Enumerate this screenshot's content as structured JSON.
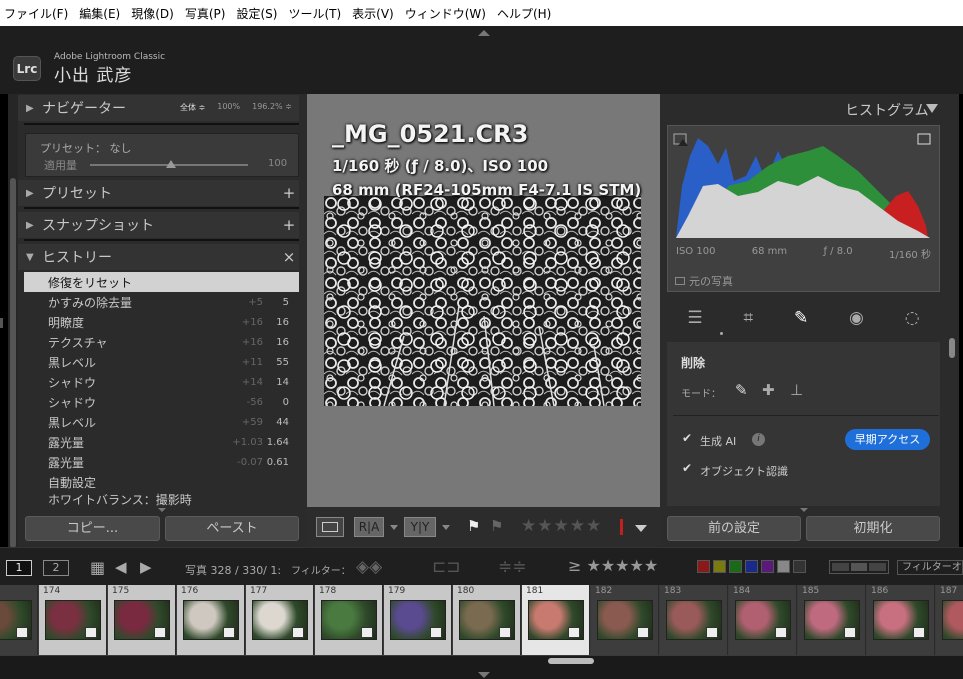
{
  "menubar": {
    "items": [
      "ファイル(F)",
      "編集(E)",
      "現像(D)",
      "写真(P)",
      "設定(S)",
      "ツール(T)",
      "表示(V)",
      "ウィンドウ(W)",
      "ヘルプ(H)"
    ]
  },
  "identity": {
    "logo": "Lrc",
    "app": "Adobe Lightroom Classic",
    "user": "小出 武彦"
  },
  "left": {
    "navigator": {
      "title": "ナビゲーター",
      "zooms": [
        "全体 ≑",
        "100%",
        "196.2% ≑"
      ]
    },
    "preset_row": {
      "label": "プリセット： なし",
      "amount_label": "適用量",
      "amount_value": "100",
      "amount_level": 0.5
    },
    "presets": {
      "title": "プリセット",
      "action": "+"
    },
    "snapshots": {
      "title": "スナップショット",
      "action": "+"
    },
    "history": {
      "title": "ヒストリー",
      "action": "×",
      "items": [
        {
          "name": "修復をリセット",
          "before": "",
          "after": ""
        },
        {
          "name": "かすみの除去量",
          "before": "+5",
          "after": "5"
        },
        {
          "name": "明瞭度",
          "before": "+16",
          "after": "16"
        },
        {
          "name": "テクスチャ",
          "before": "+16",
          "after": "16"
        },
        {
          "name": "黒レベル",
          "before": "+11",
          "after": "55"
        },
        {
          "name": "シャドウ",
          "before": "+14",
          "after": "14"
        },
        {
          "name": "シャドウ",
          "before": "-56",
          "after": "0"
        },
        {
          "name": "黒レベル",
          "before": "+59",
          "after": "44"
        },
        {
          "name": "露光量",
          "before": "+1.03",
          "after": "1.64"
        },
        {
          "name": "露光量",
          "before": "-0.07",
          "after": "0.61"
        },
        {
          "name": "自動設定",
          "before": "",
          "after": ""
        },
        {
          "name": "ホワイトバランス：撮影時",
          "before": "",
          "after": ""
        }
      ]
    },
    "copy_btn": "コピー...",
    "paste_btn": "ペースト"
  },
  "center": {
    "filename": "_MG_0521.CR3",
    "exposure": "1/160 秒 (ƒ / 8.0)、ISO 100",
    "lens": "68 mm (RF24-105mm F4-7.1 IS STM)",
    "toolbar": {
      "rating_stars": "★★★★★"
    }
  },
  "right": {
    "histogram": {
      "title": "ヒストグラム",
      "iso": "ISO 100",
      "focal": "68 mm",
      "aperture": "ƒ / 8.0",
      "shutter": "1/160 秒",
      "original": "元の写真"
    },
    "remove": {
      "title": "削除",
      "mode_label": "モード：",
      "gen_ai_label": "生成 AI",
      "early_access": "早期アクセス",
      "object_detect": "オブジェクト認識"
    },
    "prev_btn": "前の設定",
    "reset_btn": "初期化"
  },
  "filmbar": {
    "screen1": "1",
    "screen2": "2",
    "photo_info": "写真 328 / 330/ 1:",
    "filter_label": "フィルター：",
    "stars": "≥ ★★★★★",
    "filter_off": "フィルターオフ"
  },
  "colors": {
    "accent": "#1e6fd9",
    "panel": "#2b2b2b",
    "selected": "#d2d2d2"
  },
  "film": [
    {
      "n": "",
      "sel": false
    },
    {
      "n": "174",
      "sel": false
    },
    {
      "n": "175",
      "sel": false
    },
    {
      "n": "176",
      "sel": false
    },
    {
      "n": "177",
      "sel": false
    },
    {
      "n": "178",
      "sel": false
    },
    {
      "n": "179",
      "sel": false
    },
    {
      "n": "180",
      "sel": false
    },
    {
      "n": "181",
      "sel": true
    },
    {
      "n": "182",
      "sel": false
    },
    {
      "n": "183",
      "sel": false
    },
    {
      "n": "184",
      "sel": false
    },
    {
      "n": "185",
      "sel": false
    },
    {
      "n": "186",
      "sel": false
    },
    {
      "n": "187",
      "sel": false
    }
  ]
}
